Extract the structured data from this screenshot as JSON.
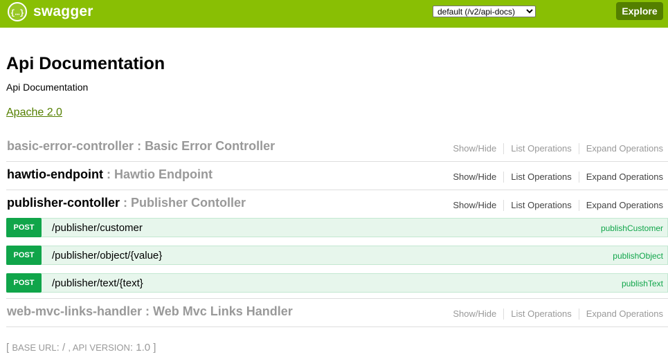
{
  "header": {
    "logo_text": "swagger",
    "logo_icon": "braces-icon",
    "spec_selected": "default (/v2/api-docs)",
    "explore_label": "Explore",
    "colors": {
      "bar": "#89bf04",
      "button": "#547f00"
    }
  },
  "info": {
    "title": "Api Documentation",
    "description": "Api Documentation",
    "license": "Apache 2.0"
  },
  "resources": [
    {
      "name": "basic-error-controller",
      "sep": " : ",
      "description": "Basic Error Controller",
      "active": false,
      "show_hide": "Show/Hide",
      "list_ops": "List Operations",
      "expand_ops": "Expand Operations"
    },
    {
      "name": "hawtio-endpoint",
      "sep": " : ",
      "description": "Hawtio Endpoint",
      "active": true,
      "show_hide": "Show/Hide",
      "list_ops": "List Operations",
      "expand_ops": "Expand Operations"
    },
    {
      "name": "publisher-contoller",
      "sep": " : ",
      "description": "Publisher Contoller",
      "active": true,
      "show_hide": "Show/Hide",
      "list_ops": "List Operations",
      "expand_ops": "Expand Operations",
      "operations": [
        {
          "method": "POST",
          "path": "/publisher/customer",
          "nickname": "publishCustomer"
        },
        {
          "method": "POST",
          "path": "/publisher/object/{value}",
          "nickname": "publishObject"
        },
        {
          "method": "POST",
          "path": "/publisher/text/{text}",
          "nickname": "publishText"
        }
      ]
    },
    {
      "name": "web-mvc-links-handler",
      "sep": " : ",
      "description": "Web Mvc Links Handler",
      "active": false,
      "show_hide": "Show/Hide",
      "list_ops": "List Operations",
      "expand_ops": "Expand Operations"
    }
  ],
  "footer": {
    "open": "[ ",
    "base_url_label": "BASE URL",
    "base_url_value": ": / ",
    "sep": ", ",
    "api_version_label": "API VERSION",
    "api_version_value": ": 1.0 ",
    "close": "]"
  }
}
